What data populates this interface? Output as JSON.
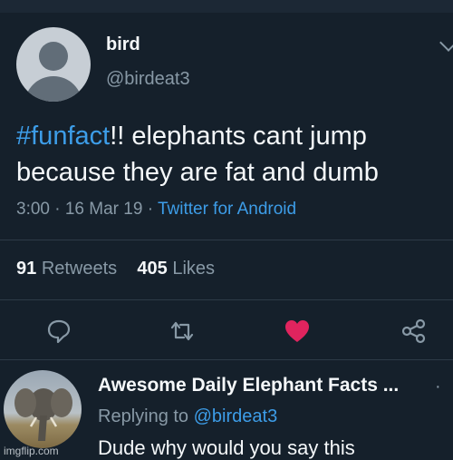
{
  "tweet": {
    "display_name": "bird",
    "handle": "@birdeat3",
    "hashtag": "#funfact",
    "text_after_hashtag": "!! elephants cant jump because they are fat and dumb",
    "meta_time": "3:00 · 16 Mar 19 · ",
    "meta_source": "Twitter for Android"
  },
  "stats": {
    "retweets_count": "91",
    "retweets_label": "Retweets",
    "likes_count": "405",
    "likes_label": "Likes"
  },
  "actions": {
    "icons": [
      "reply-icon",
      "retweet-icon",
      "like-icon",
      "share-icon"
    ],
    "like_color": "#e0245e"
  },
  "reply": {
    "display_name": "Awesome Daily Elephant Facts ...",
    "more": "·",
    "replying_prefix": "Replying to ",
    "replying_handle": "@birdeat3",
    "text": "Dude why would you say this"
  },
  "watermark": "imgflip.com",
  "colors": {
    "background": "#15202b",
    "accent": "#3d9de8",
    "muted": "#8899a6"
  }
}
